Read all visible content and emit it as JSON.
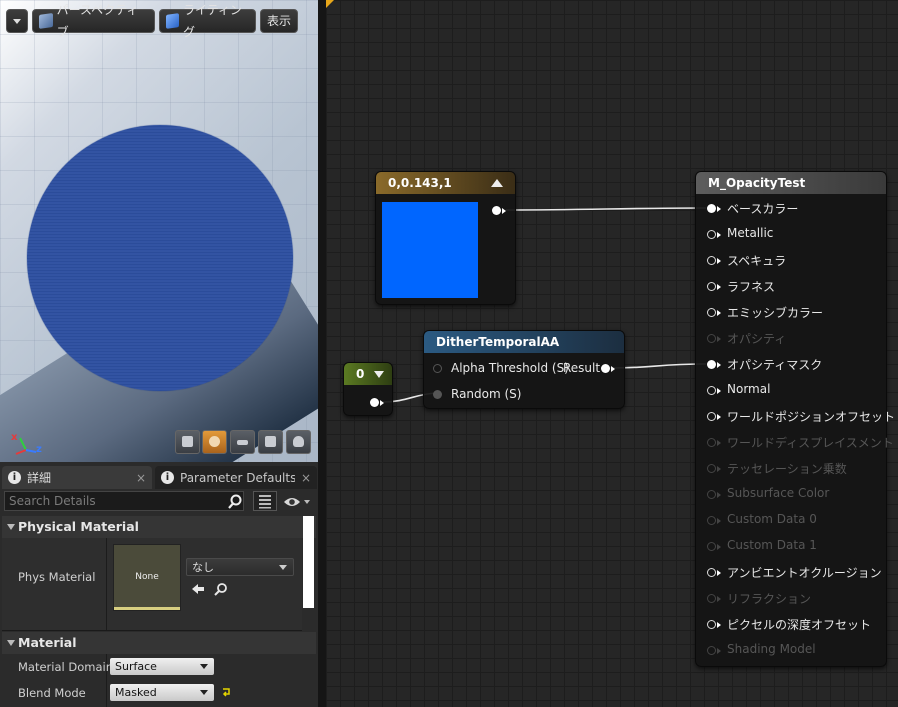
{
  "viewport": {
    "buttons": {
      "perspective": "パースペクティブ",
      "lighting": "ライティング",
      "show": "表示"
    },
    "axes": {
      "x": "x",
      "z": "z"
    },
    "preview_icons": [
      "cylinder-icon",
      "sphere-icon",
      "plane-icon",
      "cube-icon",
      "teapot-icon"
    ],
    "active_preview": "sphere-icon"
  },
  "details": {
    "tabs": [
      {
        "label": "詳細",
        "close": "×"
      },
      {
        "label": "Parameter Defaults",
        "close": "×"
      }
    ],
    "search": {
      "placeholder": "Search Details",
      "value": ""
    },
    "physical_material": {
      "title": "Physical Material",
      "label": "Phys Material",
      "thumb_text": "None",
      "combo_value": "なし"
    },
    "material": {
      "title": "Material",
      "domain_label": "Material Domain",
      "domain_value": "Surface",
      "blend_label": "Blend Mode",
      "blend_value": "Masked"
    }
  },
  "graph": {
    "constant_node": {
      "title": "0,0.143,1",
      "color": "#0066FF",
      "header_color": "#8a6a2a"
    },
    "scalar_node": {
      "title": "0",
      "header_color": "#5b7a22"
    },
    "dither_node": {
      "title": "DitherTemporalAA",
      "header_color": "#2b5a82",
      "inputs": [
        "Alpha Threshold (S)",
        "Random (S)"
      ],
      "output": "Result"
    },
    "result_node": {
      "title": "M_OpacityTest",
      "header_color": "#5d5d5d",
      "pins": [
        {
          "label": "ベースカラー",
          "state": "connected"
        },
        {
          "label": "Metallic",
          "state": "enabled"
        },
        {
          "label": "スペキュラ",
          "state": "enabled"
        },
        {
          "label": "ラフネス",
          "state": "enabled"
        },
        {
          "label": "エミッシブカラー",
          "state": "enabled"
        },
        {
          "label": "オパシティ",
          "state": "disabled"
        },
        {
          "label": "オパシティマスク",
          "state": "connected"
        },
        {
          "label": "Normal",
          "state": "enabled"
        },
        {
          "label": "ワールドポジションオフセット",
          "state": "enabled"
        },
        {
          "label": "ワールドディスプレイスメント",
          "state": "disabled"
        },
        {
          "label": "テッセレーション乗数",
          "state": "disabled"
        },
        {
          "label": "Subsurface Color",
          "state": "disabled"
        },
        {
          "label": "Custom Data 0",
          "state": "disabled"
        },
        {
          "label": "Custom Data 1",
          "state": "disabled"
        },
        {
          "label": "アンビエントオクルージョン",
          "state": "enabled"
        },
        {
          "label": "リフラクション",
          "state": "disabled"
        },
        {
          "label": "ピクセルの深度オフセット",
          "state": "enabled"
        },
        {
          "label": "Shading Model",
          "state": "disabled"
        }
      ]
    }
  }
}
